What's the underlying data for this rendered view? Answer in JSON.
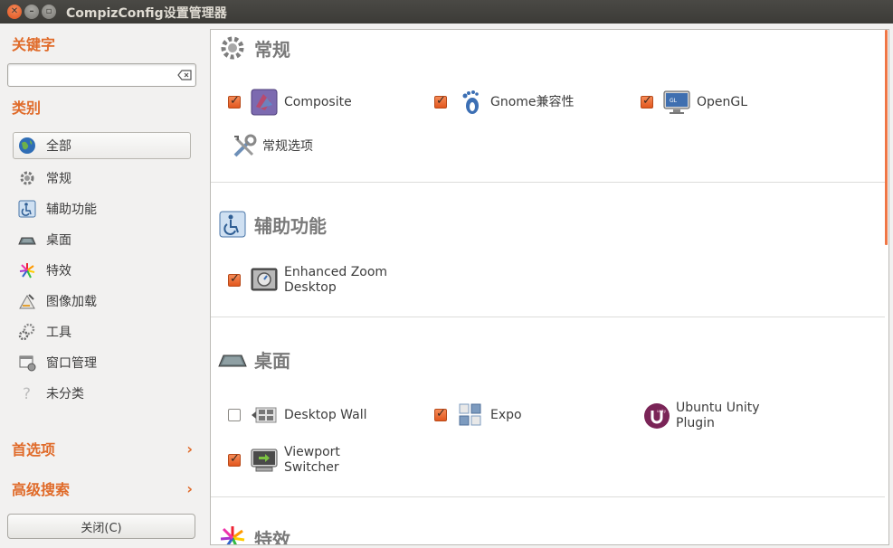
{
  "window": {
    "title": "CompizConfig设置管理器"
  },
  "sidebar": {
    "keyword_heading": "关键字",
    "search": {
      "value": "",
      "placeholder": ""
    },
    "category_heading": "类别",
    "categories": [
      {
        "label": "全部",
        "icon": "globe-icon",
        "selected": true
      },
      {
        "label": "常规",
        "icon": "gear-icon"
      },
      {
        "label": "辅助功能",
        "icon": "accessibility-icon"
      },
      {
        "label": "桌面",
        "icon": "desktop-icon"
      },
      {
        "label": "特效",
        "icon": "effects-icon"
      },
      {
        "label": "图像加载",
        "icon": "image-loading-icon"
      },
      {
        "label": "工具",
        "icon": "utility-icon"
      },
      {
        "label": "窗口管理",
        "icon": "window-management-icon"
      },
      {
        "label": "未分类",
        "icon": "question-icon"
      }
    ],
    "preferences_label": "首选项",
    "advanced_search_label": "高级搜索",
    "close_label": "关闭(C)"
  },
  "main": {
    "sections": [
      {
        "title": "常规",
        "icon": "gear-icon",
        "plugins": [
          {
            "label": "Composite",
            "checked": true,
            "icon": "composite-icon"
          },
          {
            "label": "Gnome兼容性",
            "checked": true,
            "icon": "gnome-foot-icon"
          },
          {
            "label": "OpenGL",
            "checked": true,
            "icon": "opengl-monitor-icon"
          },
          {
            "label": "常规选项",
            "checked": null,
            "icon": "tools-icon"
          }
        ]
      },
      {
        "title": "辅助功能",
        "icon": "accessibility-icon",
        "plugins": [
          {
            "label": "Enhanced Zoom Desktop",
            "line1": "Enhanced Zoom",
            "line2": "Desktop",
            "checked": true,
            "icon": "zoom-icon"
          }
        ]
      },
      {
        "title": "桌面",
        "icon": "desktop-icon",
        "plugins": [
          {
            "label": "Desktop Wall",
            "checked": false,
            "icon": "desktop-wall-icon"
          },
          {
            "label": "Expo",
            "checked": true,
            "icon": "expo-icon"
          },
          {
            "label": "Ubuntu Unity Plugin",
            "line1": "Ubuntu Unity",
            "line2": "Plugin",
            "checked": null,
            "icon": "unity-icon"
          },
          {
            "label": "Viewport Switcher",
            "line1": "Viewport",
            "line2": "Switcher",
            "checked": true,
            "icon": "viewport-switcher-icon"
          }
        ]
      },
      {
        "title": "特效",
        "icon": "effects-icon",
        "plugins": []
      }
    ]
  },
  "colors": {
    "accent": "#e06b2a",
    "titlebar": "#3c3b37",
    "checkbox": "#f07746"
  }
}
